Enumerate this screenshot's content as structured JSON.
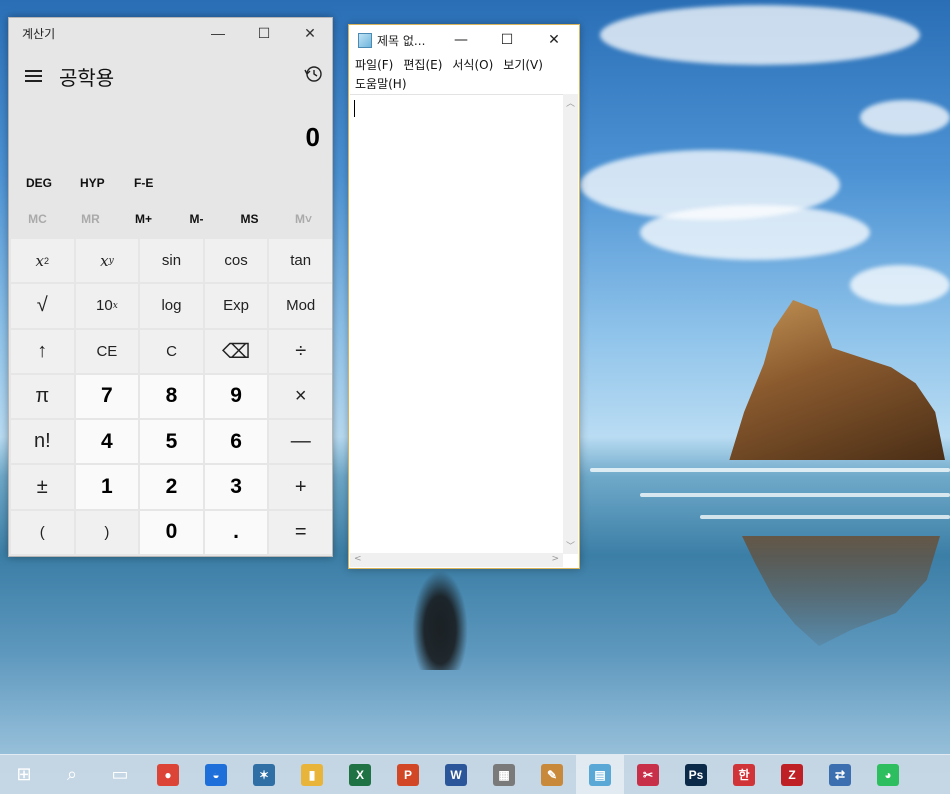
{
  "calculator": {
    "window_title": "계산기",
    "mode_title": "공학용",
    "display_value": "0",
    "angle_buttons": [
      "DEG",
      "HYP",
      "F-E"
    ],
    "memory_buttons": [
      "MC",
      "MR",
      "M+",
      "M-",
      "MS",
      "M˅"
    ],
    "window_controls": [
      "—",
      "☐",
      "✕"
    ],
    "keys": {
      "x_squared": "x",
      "x_squared_sup": "2",
      "x_pow_y": "x",
      "x_pow_y_sup": "y",
      "sin": "sin",
      "cos": "cos",
      "tan": "tan",
      "sqrt": "√",
      "ten_pow_x": "10",
      "ten_pow_x_sup": "x",
      "log": "log",
      "exp": "Exp",
      "mod": "Mod",
      "shift": "↑",
      "ce": "CE",
      "c": "C",
      "backspace": "⌫",
      "divide": "÷",
      "pi": "π",
      "seven": "7",
      "eight": "8",
      "nine": "9",
      "multiply": "×",
      "factorial": "n!",
      "four": "4",
      "five": "5",
      "six": "6",
      "minus": "—",
      "plus_minus": "±",
      "one": "1",
      "two": "2",
      "three": "3",
      "plus": "+",
      "open_paren": "(",
      "close_paren": ")",
      "zero": "0",
      "decimal": ".",
      "equals": "="
    }
  },
  "notepad": {
    "window_title": "제목 없...",
    "window_controls": [
      "—",
      "☐",
      "✕"
    ],
    "menu": {
      "file": "파일(F)",
      "edit": "편집(E)",
      "format": "서식(O)",
      "view": "보기(V)",
      "help": "도움말(H)"
    },
    "text": ""
  },
  "taskbar": {
    "items": [
      {
        "name": "start",
        "icon": "windows-logo-icon",
        "label": "⊞",
        "color": "#ffffff"
      },
      {
        "name": "search",
        "icon": "search-icon",
        "label": "⌕",
        "color": "#ffffff"
      },
      {
        "name": "task-view",
        "icon": "task-view-icon",
        "label": "▭",
        "color": "#ffffff"
      },
      {
        "name": "chrome",
        "icon": "chrome-icon",
        "label": "●",
        "color": "#db4437"
      },
      {
        "name": "edge-like",
        "icon": "browser-icon",
        "label": "◒",
        "color": "#1e6fd9"
      },
      {
        "name": "app-bird",
        "icon": "bird-app-icon",
        "label": "✶",
        "color": "#2f6fa5"
      },
      {
        "name": "explorer",
        "icon": "file-explorer-icon",
        "label": "▮",
        "color": "#e8b43a"
      },
      {
        "name": "excel",
        "icon": "excel-icon",
        "label": "X",
        "color": "#1f7244"
      },
      {
        "name": "powerpoint",
        "icon": "powerpoint-icon",
        "label": "P",
        "color": "#d24726"
      },
      {
        "name": "word",
        "icon": "word-icon",
        "label": "W",
        "color": "#2b579a"
      },
      {
        "name": "calculator",
        "icon": "calculator-icon",
        "label": "▦",
        "color": "#7a7a7a"
      },
      {
        "name": "paint",
        "icon": "paint-icon",
        "label": "✎",
        "color": "#c9893a"
      },
      {
        "name": "notepad",
        "icon": "notepad-icon",
        "label": "▤",
        "color": "#5aa8d6"
      },
      {
        "name": "snipping",
        "icon": "snipping-tool-icon",
        "label": "✂",
        "color": "#c8304a"
      },
      {
        "name": "photoshop",
        "icon": "photoshop-icon",
        "label": "Ps",
        "color": "#0b2a4a"
      },
      {
        "name": "hwp",
        "icon": "hangul-icon",
        "label": "한",
        "color": "#d03438"
      },
      {
        "name": "filezilla",
        "icon": "filezilla-icon",
        "label": "Z",
        "color": "#bf2026"
      },
      {
        "name": "network",
        "icon": "network-icon",
        "label": "⇄",
        "color": "#3b6fb0"
      },
      {
        "name": "evernote",
        "icon": "evernote-icon",
        "label": "◕",
        "color": "#2dbe60"
      }
    ]
  }
}
